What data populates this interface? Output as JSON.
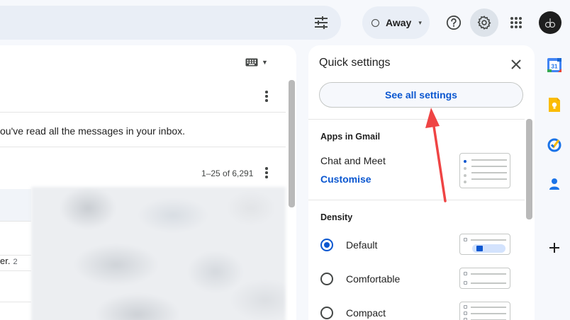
{
  "header": {
    "status_label": "Away",
    "icons": {
      "tune": "tune-icon",
      "help": "help-icon",
      "settings": "gear-icon",
      "apps": "apps-grid-icon",
      "avatar": "avatar"
    }
  },
  "mail": {
    "read_message": "ou've read all the messages in your inbox.",
    "pager": "1–25 of 6,291",
    "partial_row_text": "er.",
    "partial_row_count": "2"
  },
  "quick_settings": {
    "title": "Quick settings",
    "see_all_label": "See all settings",
    "apps_section": "Apps in Gmail",
    "chat_meet_label": "Chat and Meet",
    "customise_label": "Customise",
    "density_section": "Density",
    "density_options": [
      {
        "label": "Default",
        "selected": true
      },
      {
        "label": "Comfortable",
        "selected": false
      },
      {
        "label": "Compact",
        "selected": false
      }
    ]
  },
  "side_rail": {
    "calendar_day": "31",
    "apps": [
      "calendar-icon",
      "keep-icon",
      "tasks-icon",
      "contacts-icon",
      "add-icon"
    ]
  },
  "colors": {
    "accent": "#0b57d0",
    "background": "#f6f8fc",
    "annotation_arrow": "#ef4444"
  }
}
